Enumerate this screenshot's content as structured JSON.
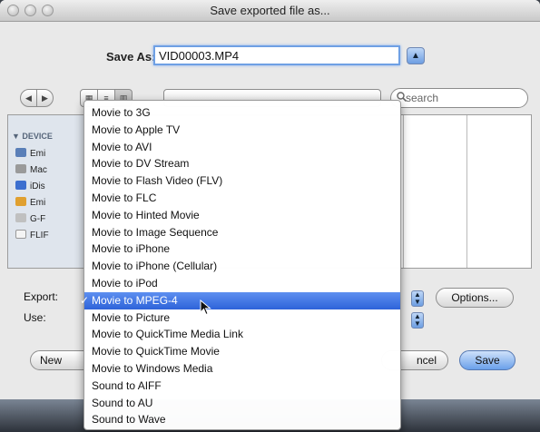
{
  "window": {
    "title": "Save exported file as..."
  },
  "save_as": {
    "label": "Save As:",
    "value": "VID00003.MP4"
  },
  "search": {
    "placeholder": "search"
  },
  "sidebar": {
    "header": "▼ DEVICE",
    "items": [
      {
        "label": "Emi",
        "icon": "display-icon"
      },
      {
        "label": "Mac",
        "icon": "drive-icon"
      },
      {
        "label": "iDis",
        "icon": "idisk-icon"
      },
      {
        "label": "Emi",
        "icon": "drive-icon"
      },
      {
        "label": "G-F",
        "icon": "drive-icon"
      },
      {
        "label": "FLIF",
        "icon": "drive-icon"
      }
    ]
  },
  "export": {
    "label": "Export:",
    "use_label": "Use:",
    "options_label": "Options..."
  },
  "buttons": {
    "new_folder": "New",
    "cancel": "ncel",
    "save": "Save"
  },
  "menu": {
    "selected_index": 11,
    "items": [
      "Movie to 3G",
      "Movie to Apple TV",
      "Movie to AVI",
      "Movie to DV Stream",
      "Movie to Flash Video (FLV)",
      "Movie to FLC",
      "Movie to Hinted Movie",
      "Movie to Image Sequence",
      "Movie to iPhone",
      "Movie to iPhone (Cellular)",
      "Movie to iPod",
      "Movie to MPEG-4",
      "Movie to Picture",
      "Movie to QuickTime Media Link",
      "Movie to QuickTime Movie",
      "Movie to Windows Media",
      "Sound to AIFF",
      "Sound to AU",
      "Sound to Wave"
    ]
  },
  "colors": {
    "selection": "#2e63d9",
    "focus_ring": "#6fa0e4"
  }
}
